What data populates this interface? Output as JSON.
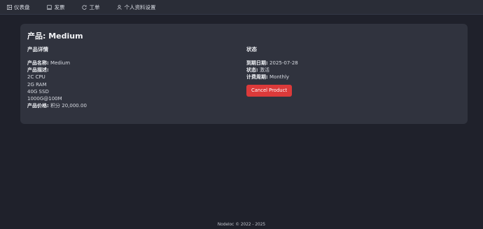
{
  "nav": {
    "items": [
      {
        "label": "仪表盘",
        "icon": "dashboard-icon"
      },
      {
        "label": "发票",
        "icon": "invoice-icon"
      },
      {
        "label": "工单",
        "icon": "ticket-icon"
      },
      {
        "label": "个人资料设置",
        "icon": "user-icon"
      }
    ]
  },
  "product": {
    "title": "产品: Medium",
    "details_heading": "产品详情",
    "name_label": "产品名称:",
    "name_value": "Medium",
    "desc_label": "产品描述:",
    "desc_lines": [
      "2C CPU",
      "2G RAM",
      "40G SSD",
      "1000G@100M"
    ],
    "price_label": "产品价格:",
    "price_value": "积分 20,000.00"
  },
  "status": {
    "heading": "状态",
    "expiry_label": "到期日期:",
    "expiry_value": "2025-07-28",
    "state_label": "状态:",
    "state_value": "激活",
    "cycle_label": "计费周期:",
    "cycle_value": "Monthly",
    "cancel_label": "Cancel Product",
    "cancel_color": "#dc3a3a"
  },
  "footer": {
    "text": "Nodeloc © 2022 - 2025"
  }
}
